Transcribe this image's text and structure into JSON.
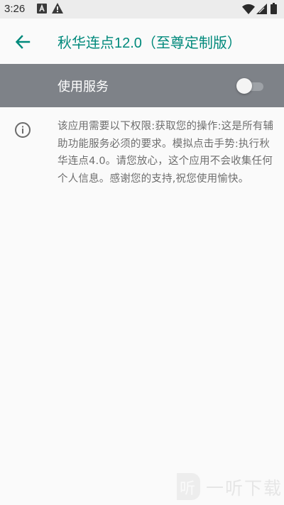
{
  "status_bar": {
    "time": "3:26",
    "icons": [
      "a-square-icon",
      "warning-icon",
      "wifi-icon",
      "signal-icon",
      "battery-icon"
    ]
  },
  "app_bar": {
    "title": "秋华连点12.0（至尊定制版）",
    "accent_color": "#00897b"
  },
  "service_switch": {
    "label": "使用服务",
    "enabled": false,
    "bar_color": "#7e8288"
  },
  "description": "该应用需要以下权限:获取您的操作:这是所有辅助功能服务必须的要求。模拟点击手势:执行秋华连点4.0。请您放心，这个应用不会收集任何个人信息。感谢您的支持,祝您使用愉快。",
  "watermark": {
    "text": "一听下载"
  }
}
